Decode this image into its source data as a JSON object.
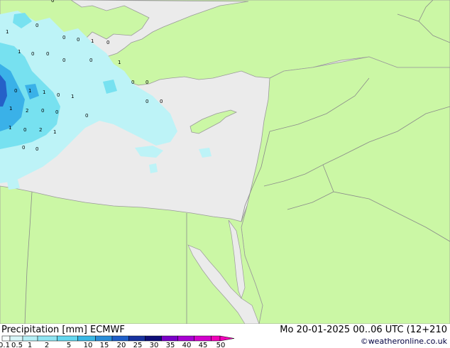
{
  "map": {
    "colors": {
      "sea_dry": "#ebebeb",
      "land": "#cbf7a5",
      "precip_light": "#bdf3f7",
      "precip_mid": "#77e1f0",
      "precip_heavy": "#3ab1e8",
      "precip_max": "#2560c8",
      "border": "#8a8a8a",
      "coast": "#9a9a9a"
    },
    "station_values": [
      "0",
      "1",
      "1",
      "0",
      "0",
      "0",
      "1",
      "0",
      "0",
      "0",
      "0",
      "0",
      "1",
      "0",
      "1",
      "1",
      "0",
      "2",
      "0",
      "1",
      "0",
      "1",
      "0",
      "2",
      "1",
      "0",
      "0",
      "1",
      "0",
      "0",
      "0",
      "0",
      "0"
    ]
  },
  "footer": {
    "title": "Precipitation [mm]  ECMWF",
    "datetime": "Mo 20-01-2025 00..06 UTC (12+210",
    "credit": "©weatheronline.co.uk"
  },
  "legend": {
    "labels": [
      "0.1",
      "0.5",
      "1",
      "2",
      "5",
      "10",
      "15",
      "20",
      "25",
      "30",
      "35",
      "40",
      "45",
      "50"
    ],
    "colors": [
      "#f7fdfd",
      "#d7f6f9",
      "#b5eff6",
      "#8fe5f2",
      "#63d7ef",
      "#3ab8e5",
      "#2a8dd8",
      "#1f5fc8",
      "#17329f",
      "#0e0e78",
      "#7a00c8",
      "#a800d2",
      "#d200cc",
      "#f000b8"
    ]
  }
}
